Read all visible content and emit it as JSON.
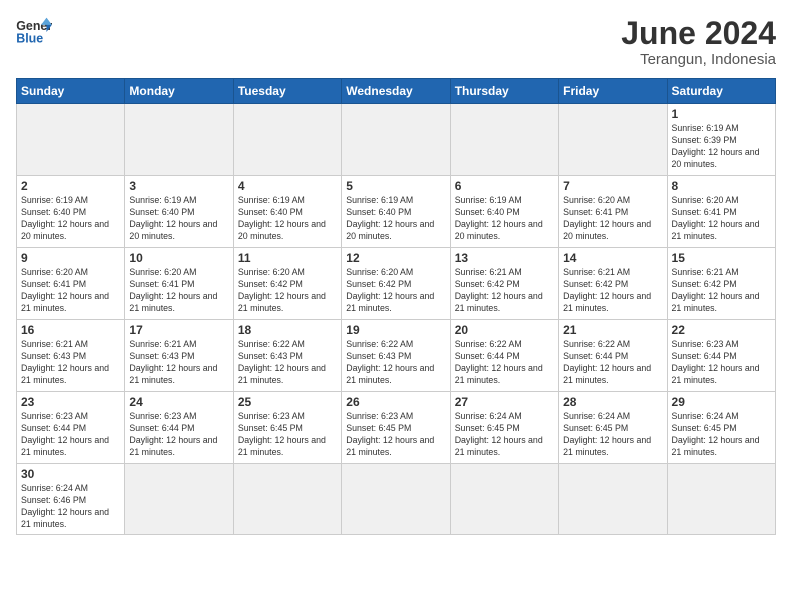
{
  "header": {
    "logo_general": "General",
    "logo_blue": "Blue",
    "title": "June 2024",
    "subtitle": "Terangun, Indonesia"
  },
  "weekdays": [
    "Sunday",
    "Monday",
    "Tuesday",
    "Wednesday",
    "Thursday",
    "Friday",
    "Saturday"
  ],
  "weeks": [
    [
      {
        "day": "",
        "empty": true
      },
      {
        "day": "",
        "empty": true
      },
      {
        "day": "",
        "empty": true
      },
      {
        "day": "",
        "empty": true
      },
      {
        "day": "",
        "empty": true
      },
      {
        "day": "",
        "empty": true
      },
      {
        "day": "1",
        "sunrise": "6:19 AM",
        "sunset": "6:39 PM",
        "daylight": "12 hours and 20 minutes."
      }
    ],
    [
      {
        "day": "2",
        "sunrise": "6:19 AM",
        "sunset": "6:40 PM",
        "daylight": "12 hours and 20 minutes."
      },
      {
        "day": "3",
        "sunrise": "6:19 AM",
        "sunset": "6:40 PM",
        "daylight": "12 hours and 20 minutes."
      },
      {
        "day": "4",
        "sunrise": "6:19 AM",
        "sunset": "6:40 PM",
        "daylight": "12 hours and 20 minutes."
      },
      {
        "day": "5",
        "sunrise": "6:19 AM",
        "sunset": "6:40 PM",
        "daylight": "12 hours and 20 minutes."
      },
      {
        "day": "6",
        "sunrise": "6:19 AM",
        "sunset": "6:40 PM",
        "daylight": "12 hours and 20 minutes."
      },
      {
        "day": "7",
        "sunrise": "6:20 AM",
        "sunset": "6:41 PM",
        "daylight": "12 hours and 20 minutes."
      },
      {
        "day": "8",
        "sunrise": "6:20 AM",
        "sunset": "6:41 PM",
        "daylight": "12 hours and 21 minutes."
      }
    ],
    [
      {
        "day": "9",
        "sunrise": "6:20 AM",
        "sunset": "6:41 PM",
        "daylight": "12 hours and 21 minutes."
      },
      {
        "day": "10",
        "sunrise": "6:20 AM",
        "sunset": "6:41 PM",
        "daylight": "12 hours and 21 minutes."
      },
      {
        "day": "11",
        "sunrise": "6:20 AM",
        "sunset": "6:42 PM",
        "daylight": "12 hours and 21 minutes."
      },
      {
        "day": "12",
        "sunrise": "6:20 AM",
        "sunset": "6:42 PM",
        "daylight": "12 hours and 21 minutes."
      },
      {
        "day": "13",
        "sunrise": "6:21 AM",
        "sunset": "6:42 PM",
        "daylight": "12 hours and 21 minutes."
      },
      {
        "day": "14",
        "sunrise": "6:21 AM",
        "sunset": "6:42 PM",
        "daylight": "12 hours and 21 minutes."
      },
      {
        "day": "15",
        "sunrise": "6:21 AM",
        "sunset": "6:42 PM",
        "daylight": "12 hours and 21 minutes."
      }
    ],
    [
      {
        "day": "16",
        "sunrise": "6:21 AM",
        "sunset": "6:43 PM",
        "daylight": "12 hours and 21 minutes."
      },
      {
        "day": "17",
        "sunrise": "6:21 AM",
        "sunset": "6:43 PM",
        "daylight": "12 hours and 21 minutes."
      },
      {
        "day": "18",
        "sunrise": "6:22 AM",
        "sunset": "6:43 PM",
        "daylight": "12 hours and 21 minutes."
      },
      {
        "day": "19",
        "sunrise": "6:22 AM",
        "sunset": "6:43 PM",
        "daylight": "12 hours and 21 minutes."
      },
      {
        "day": "20",
        "sunrise": "6:22 AM",
        "sunset": "6:44 PM",
        "daylight": "12 hours and 21 minutes."
      },
      {
        "day": "21",
        "sunrise": "6:22 AM",
        "sunset": "6:44 PM",
        "daylight": "12 hours and 21 minutes."
      },
      {
        "day": "22",
        "sunrise": "6:23 AM",
        "sunset": "6:44 PM",
        "daylight": "12 hours and 21 minutes."
      }
    ],
    [
      {
        "day": "23",
        "sunrise": "6:23 AM",
        "sunset": "6:44 PM",
        "daylight": "12 hours and 21 minutes."
      },
      {
        "day": "24",
        "sunrise": "6:23 AM",
        "sunset": "6:44 PM",
        "daylight": "12 hours and 21 minutes."
      },
      {
        "day": "25",
        "sunrise": "6:23 AM",
        "sunset": "6:45 PM",
        "daylight": "12 hours and 21 minutes."
      },
      {
        "day": "26",
        "sunrise": "6:23 AM",
        "sunset": "6:45 PM",
        "daylight": "12 hours and 21 minutes."
      },
      {
        "day": "27",
        "sunrise": "6:24 AM",
        "sunset": "6:45 PM",
        "daylight": "12 hours and 21 minutes."
      },
      {
        "day": "28",
        "sunrise": "6:24 AM",
        "sunset": "6:45 PM",
        "daylight": "12 hours and 21 minutes."
      },
      {
        "day": "29",
        "sunrise": "6:24 AM",
        "sunset": "6:45 PM",
        "daylight": "12 hours and 21 minutes."
      }
    ],
    [
      {
        "day": "30",
        "sunrise": "6:24 AM",
        "sunset": "6:46 PM",
        "daylight": "12 hours and 21 minutes."
      },
      {
        "day": "",
        "empty": true
      },
      {
        "day": "",
        "empty": true
      },
      {
        "day": "",
        "empty": true
      },
      {
        "day": "",
        "empty": true
      },
      {
        "day": "",
        "empty": true
      },
      {
        "day": "",
        "empty": true
      }
    ]
  ]
}
